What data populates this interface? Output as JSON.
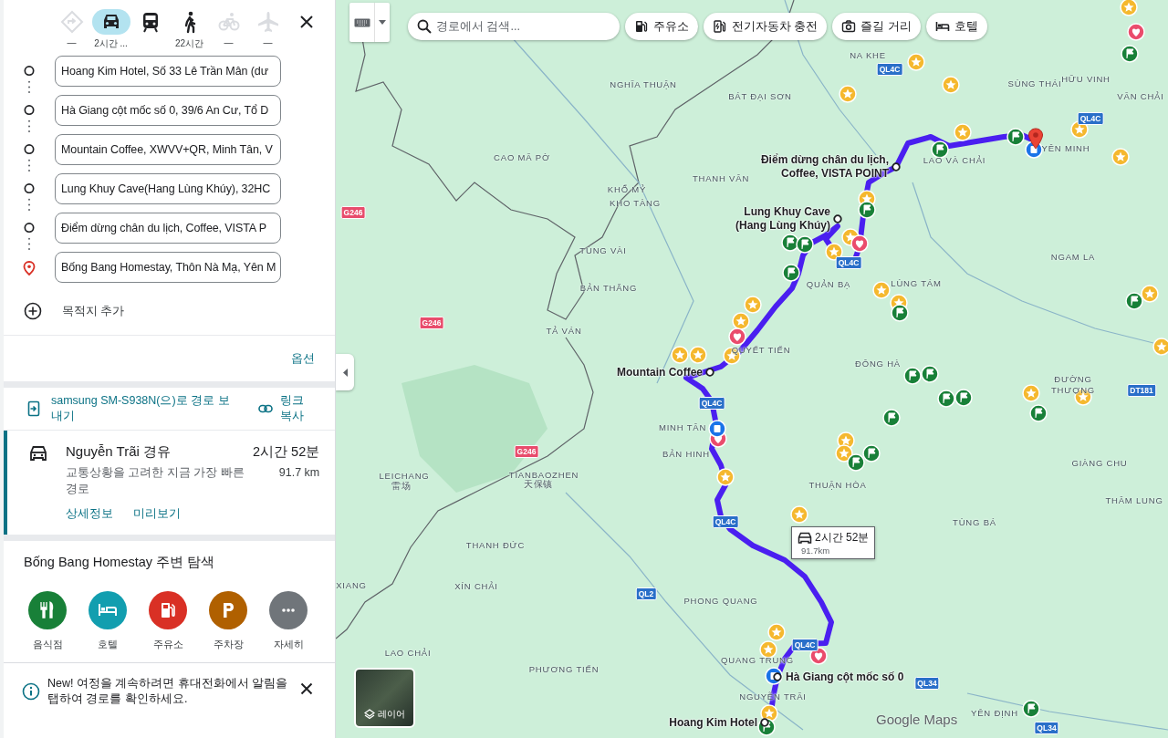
{
  "travel_modes": [
    {
      "kind": "best",
      "label": "—",
      "selected": false,
      "disabled": true
    },
    {
      "kind": "car",
      "label": "2시간 ...",
      "selected": true,
      "disabled": false
    },
    {
      "kind": "transit",
      "selected": false,
      "disabled": false
    },
    {
      "kind": "walk",
      "label": "22시간",
      "selected": false,
      "disabled": false
    },
    {
      "kind": "bike",
      "label": "—",
      "selected": false,
      "disabled": true
    },
    {
      "kind": "flight",
      "label": "—",
      "selected": false,
      "disabled": true
    }
  ],
  "waypoints": [
    {
      "kind": "stop",
      "value": "Hoang Kim Hotel, Số 33 Lê Trần Mân (dư"
    },
    {
      "kind": "stop",
      "value": "Hà Giang cột mốc số 0, 39/6 An Cư, Tổ D"
    },
    {
      "kind": "stop",
      "value": "Mountain Coffee, XWVV+QR, Minh Tân, V"
    },
    {
      "kind": "stop",
      "value": "Lung Khuy Cave(Hang Lùng Khúy), 32HC"
    },
    {
      "kind": "stop",
      "value": "Điểm dừng chân du lịch, Coffee, VISTA P"
    },
    {
      "kind": "destination",
      "value": "Bống Bang Homestay, Thôn Nà Mạ, Yên M"
    }
  ],
  "add_destination": "목적지 추가",
  "options_link": "옵션",
  "send_to_device": "samsung SM-S938N(으)로 경로 보내기",
  "copy_link": "링크 복사",
  "route": {
    "title": "Nguyễn Trãi 경유",
    "duration": "2시간 52분",
    "description": "교통상황을 고려한 지금 가장 빠른 경로",
    "distance": "91.7 km",
    "selected": true,
    "links": [
      "상세정보",
      "미리보기"
    ]
  },
  "explore": {
    "title": "Bống Bang Homestay 주변 탐색",
    "categories": [
      {
        "kind": "restaurant",
        "label": "음식점",
        "color": "#188038"
      },
      {
        "kind": "hotel",
        "label": "호텔",
        "color": "#129eaf"
      },
      {
        "kind": "gas",
        "label": "주유소",
        "color": "#d93025"
      },
      {
        "kind": "parking",
        "label": "주차장",
        "color": "#b06000"
      },
      {
        "kind": "more",
        "label": "자세히",
        "color": "#70757a"
      }
    ]
  },
  "notice": "New! 여정을 계속하려면 휴대전화에서 알림을 탭하여 경로를 확인하세요.",
  "map": {
    "search": {
      "placeholder": "경로에서 검색..."
    },
    "chips": [
      {
        "kind": "gas",
        "label": "주유소"
      },
      {
        "kind": "ev",
        "label": "전기자동차 충전"
      },
      {
        "kind": "activities",
        "label": "즐길 거리"
      },
      {
        "kind": "hotel",
        "label": "호텔"
      }
    ],
    "place_labels": [
      "NGHĨA THUẬN",
      "BÁT ĐẠI SƠN",
      "NA KHE",
      "SÙNG THÁI",
      "HỮU VINH",
      "VĂN CHẢI",
      "CAO MÃ PỜ",
      "THANH VÂN",
      "KHỔ MỶ",
      "KHO TÀNG",
      "YÊN MINH",
      "LAO VÀ CHẢI",
      "TÙNG VÀI",
      "BẢN THẮNG",
      "NGAM LA",
      "QUẢN BẠ",
      "LÙNG TÁM",
      "TẢ VÁN",
      "QUYẾT TIẾN",
      "ĐÔNG HÀ",
      "ĐƯỜNG",
      "THƯỢNG",
      "MINH TÂN",
      "BẢN HINH",
      "THUẬN HÒA",
      "GIÀNG CHU",
      "TÙNG BÁ",
      "THÂM LUNG",
      "LEICHANG",
      "雷场",
      "TIANBAOZHEN",
      "天保镇",
      "THANH ĐỨC",
      "XÍN CHẢI",
      "PHONG QUANG",
      "LAO CHẢI",
      "PHƯƠNG TIẾN",
      "QUANG TRUNG",
      "NGUYỄN TRÃI",
      "YÊN ĐỊNH",
      "XIANG"
    ],
    "waypoint_labels": [
      "Điểm dừng chân du lịch, Coffee, VISTA POINT",
      "Lung Khuy Cave (Hang Lùng Khúy)",
      "Mountain Coffee",
      "Hà Giang cột mốc số 0",
      "Hoang Kim Hotel"
    ],
    "road_shields": [
      {
        "kind": "national",
        "label": "QL4C"
      },
      {
        "kind": "national",
        "label": "QL4C"
      },
      {
        "kind": "national",
        "label": "QL4C"
      },
      {
        "kind": "national",
        "label": "QL4C"
      },
      {
        "kind": "national",
        "label": "QL4C"
      },
      {
        "kind": "national",
        "label": "QL4C"
      },
      {
        "kind": "foreign",
        "label": "G246"
      },
      {
        "kind": "foreign",
        "label": "G246"
      },
      {
        "kind": "foreign",
        "label": "G246"
      },
      {
        "kind": "national",
        "label": "QL2"
      },
      {
        "kind": "national",
        "label": "QL34"
      },
      {
        "kind": "national",
        "label": "QL34"
      },
      {
        "kind": "national",
        "label": "DT181"
      }
    ],
    "route_callout": {
      "duration": "2시간 52분",
      "distance": "91.7km"
    },
    "layers_button": "레이어",
    "logo": "Google Maps"
  }
}
